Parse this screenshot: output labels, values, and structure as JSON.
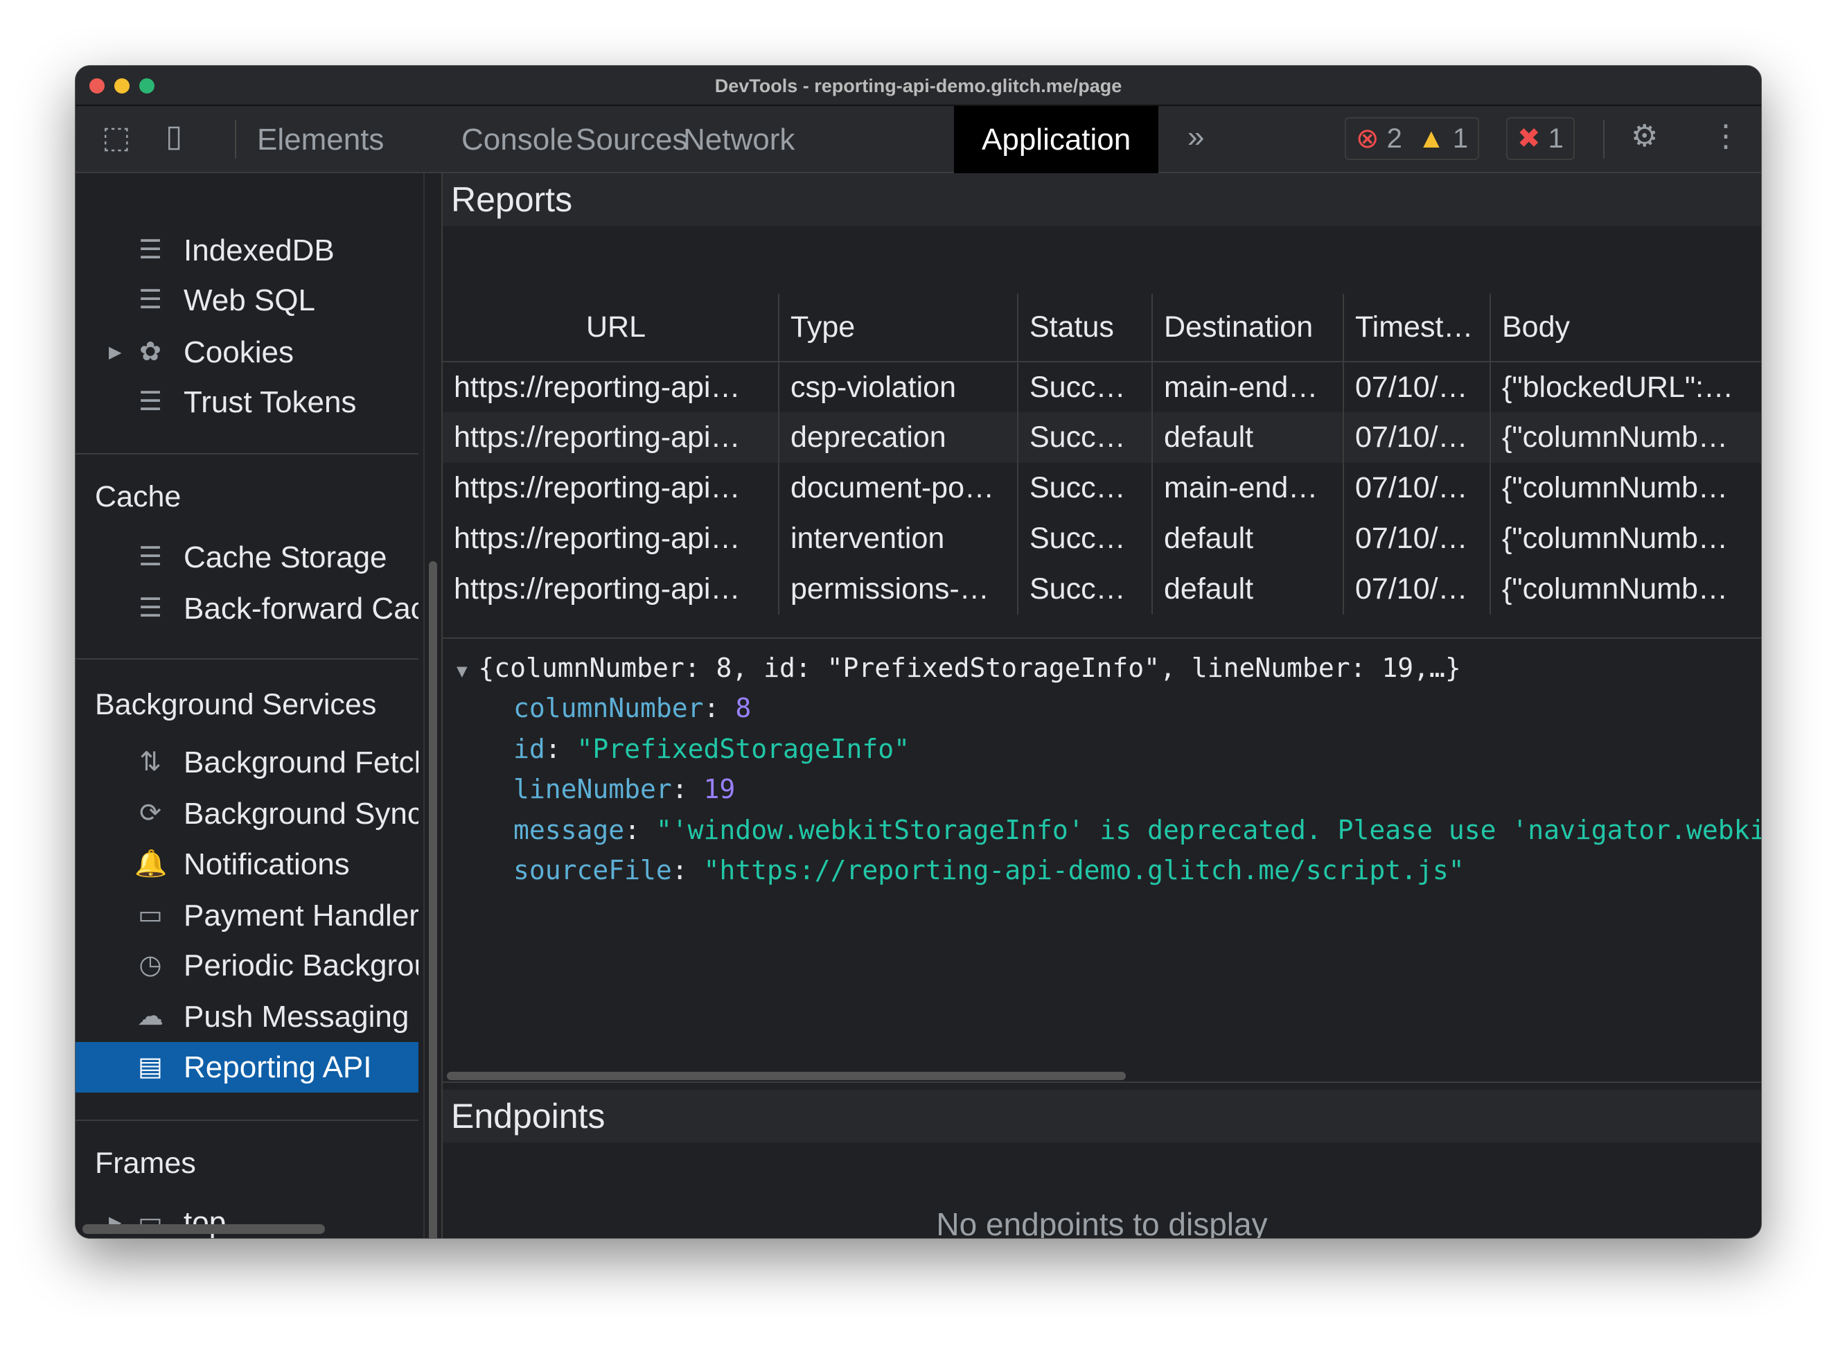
{
  "window": {
    "title": "DevTools - reporting-api-demo.glitch.me/page"
  },
  "toolbar": {
    "tabs": [
      "Elements",
      "Console",
      "Sources",
      "Network",
      "Application"
    ],
    "active": "Application",
    "errors": "2",
    "warnings": "1",
    "issues": "1"
  },
  "sidebar": {
    "storage_items": [
      {
        "label": "IndexedDB",
        "icon": "database-icon"
      },
      {
        "label": "Web SQL",
        "icon": "database-icon"
      },
      {
        "label": "Cookies",
        "icon": "cookie-icon"
      },
      {
        "label": "Trust Tokens",
        "icon": "database-icon"
      }
    ],
    "cache": {
      "title": "Cache",
      "items": [
        "Cache Storage",
        "Back-forward Cache"
      ]
    },
    "background": {
      "title": "Background Services",
      "items": [
        "Background Fetch",
        "Background Sync",
        "Notifications",
        "Payment Handler",
        "Periodic Background Sync",
        "Push Messaging",
        "Reporting API"
      ]
    },
    "frames": {
      "title": "Frames",
      "items": [
        "top"
      ]
    }
  },
  "reports": {
    "title": "Reports",
    "columns": [
      "URL",
      "Type",
      "Status",
      "Destination",
      "Timest…",
      "Body"
    ],
    "rows": [
      [
        "https://reporting-api…",
        "csp-violation",
        "Succ…",
        "main-end…",
        "07/10/…",
        "{\"blockedURL\":…"
      ],
      [
        "https://reporting-api…",
        "deprecation",
        "Succ…",
        "default",
        "07/10/…",
        "{\"columnNumb…"
      ],
      [
        "https://reporting-api…",
        "document-po…",
        "Succ…",
        "main-end…",
        "07/10/…",
        "{\"columnNumb…"
      ],
      [
        "https://reporting-api…",
        "intervention",
        "Succ…",
        "default",
        "07/10/…",
        "{\"columnNumb…"
      ],
      [
        "https://reporting-api…",
        "permissions-…",
        "Succ…",
        "default",
        "07/10/…",
        "{\"columnNumb…"
      ]
    ],
    "detail": {
      "summary": "{columnNumber: 8, id: \"PrefixedStorageInfo\", lineNumber: 19,…}",
      "props": [
        {
          "key": "columnNumber",
          "value": "8",
          "type": "n"
        },
        {
          "key": "id",
          "value": "\"PrefixedStorageInfo\"",
          "type": "s"
        },
        {
          "key": "lineNumber",
          "value": "19",
          "type": "n"
        },
        {
          "key": "message",
          "value": "\"'window.webkitStorageInfo' is deprecated. Please use 'navigator.webkitTemporaryStorage'",
          "type": "s"
        },
        {
          "key": "sourceFile",
          "value": "\"https://reporting-api-demo.glitch.me/script.js\"",
          "type": "s"
        }
      ]
    }
  },
  "endpoints": {
    "title": "Endpoints",
    "empty": "No endpoints to display"
  }
}
